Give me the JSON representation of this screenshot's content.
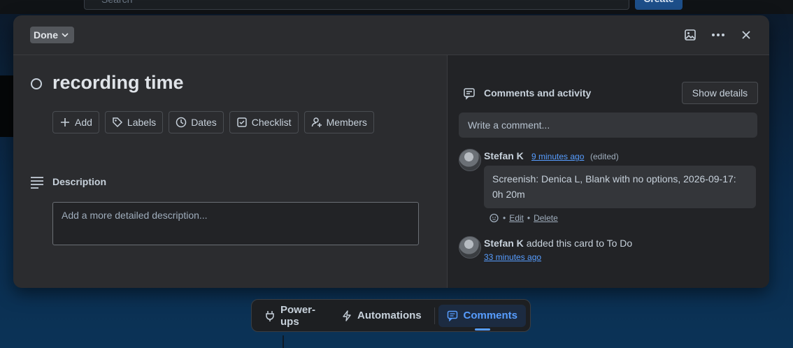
{
  "background": {
    "search_placeholder": "Search",
    "create_label": "Create"
  },
  "card": {
    "status_label": "Done",
    "title": "recording time",
    "actions": [
      {
        "label": "Add",
        "icon": "plus-icon"
      },
      {
        "label": "Labels",
        "icon": "tag-icon"
      },
      {
        "label": "Dates",
        "icon": "clock-icon"
      },
      {
        "label": "Checklist",
        "icon": "checkbox-icon"
      },
      {
        "label": "Members",
        "icon": "add-member-icon"
      }
    ],
    "description_label": "Description",
    "description_placeholder": "Add a more detailed description..."
  },
  "activity": {
    "title": "Comments and activity",
    "show_details_label": "Show details",
    "comment_placeholder": "Write a comment...",
    "comment": {
      "author": "Stefan K",
      "time": "9 minutes ago",
      "edited": "(edited)",
      "text": "Screenish: Denica L, Blank with no options, 2026-09-17: 0h 20m",
      "edit_label": "Edit",
      "delete_label": "Delete"
    },
    "event": {
      "author": "Stefan K",
      "text": "added this card to To Do",
      "time": "33 minutes ago"
    }
  },
  "dock": {
    "items": [
      {
        "label": "Power-ups",
        "icon": "plug-icon"
      },
      {
        "label": "Automations",
        "icon": "lightning-icon"
      },
      {
        "label": "Comments",
        "icon": "comment-icon"
      }
    ],
    "active": "Comments"
  },
  "colors": {
    "accent": "#579dff",
    "modal_bg": "#2b2c2f",
    "panel_bg": "#222326"
  }
}
